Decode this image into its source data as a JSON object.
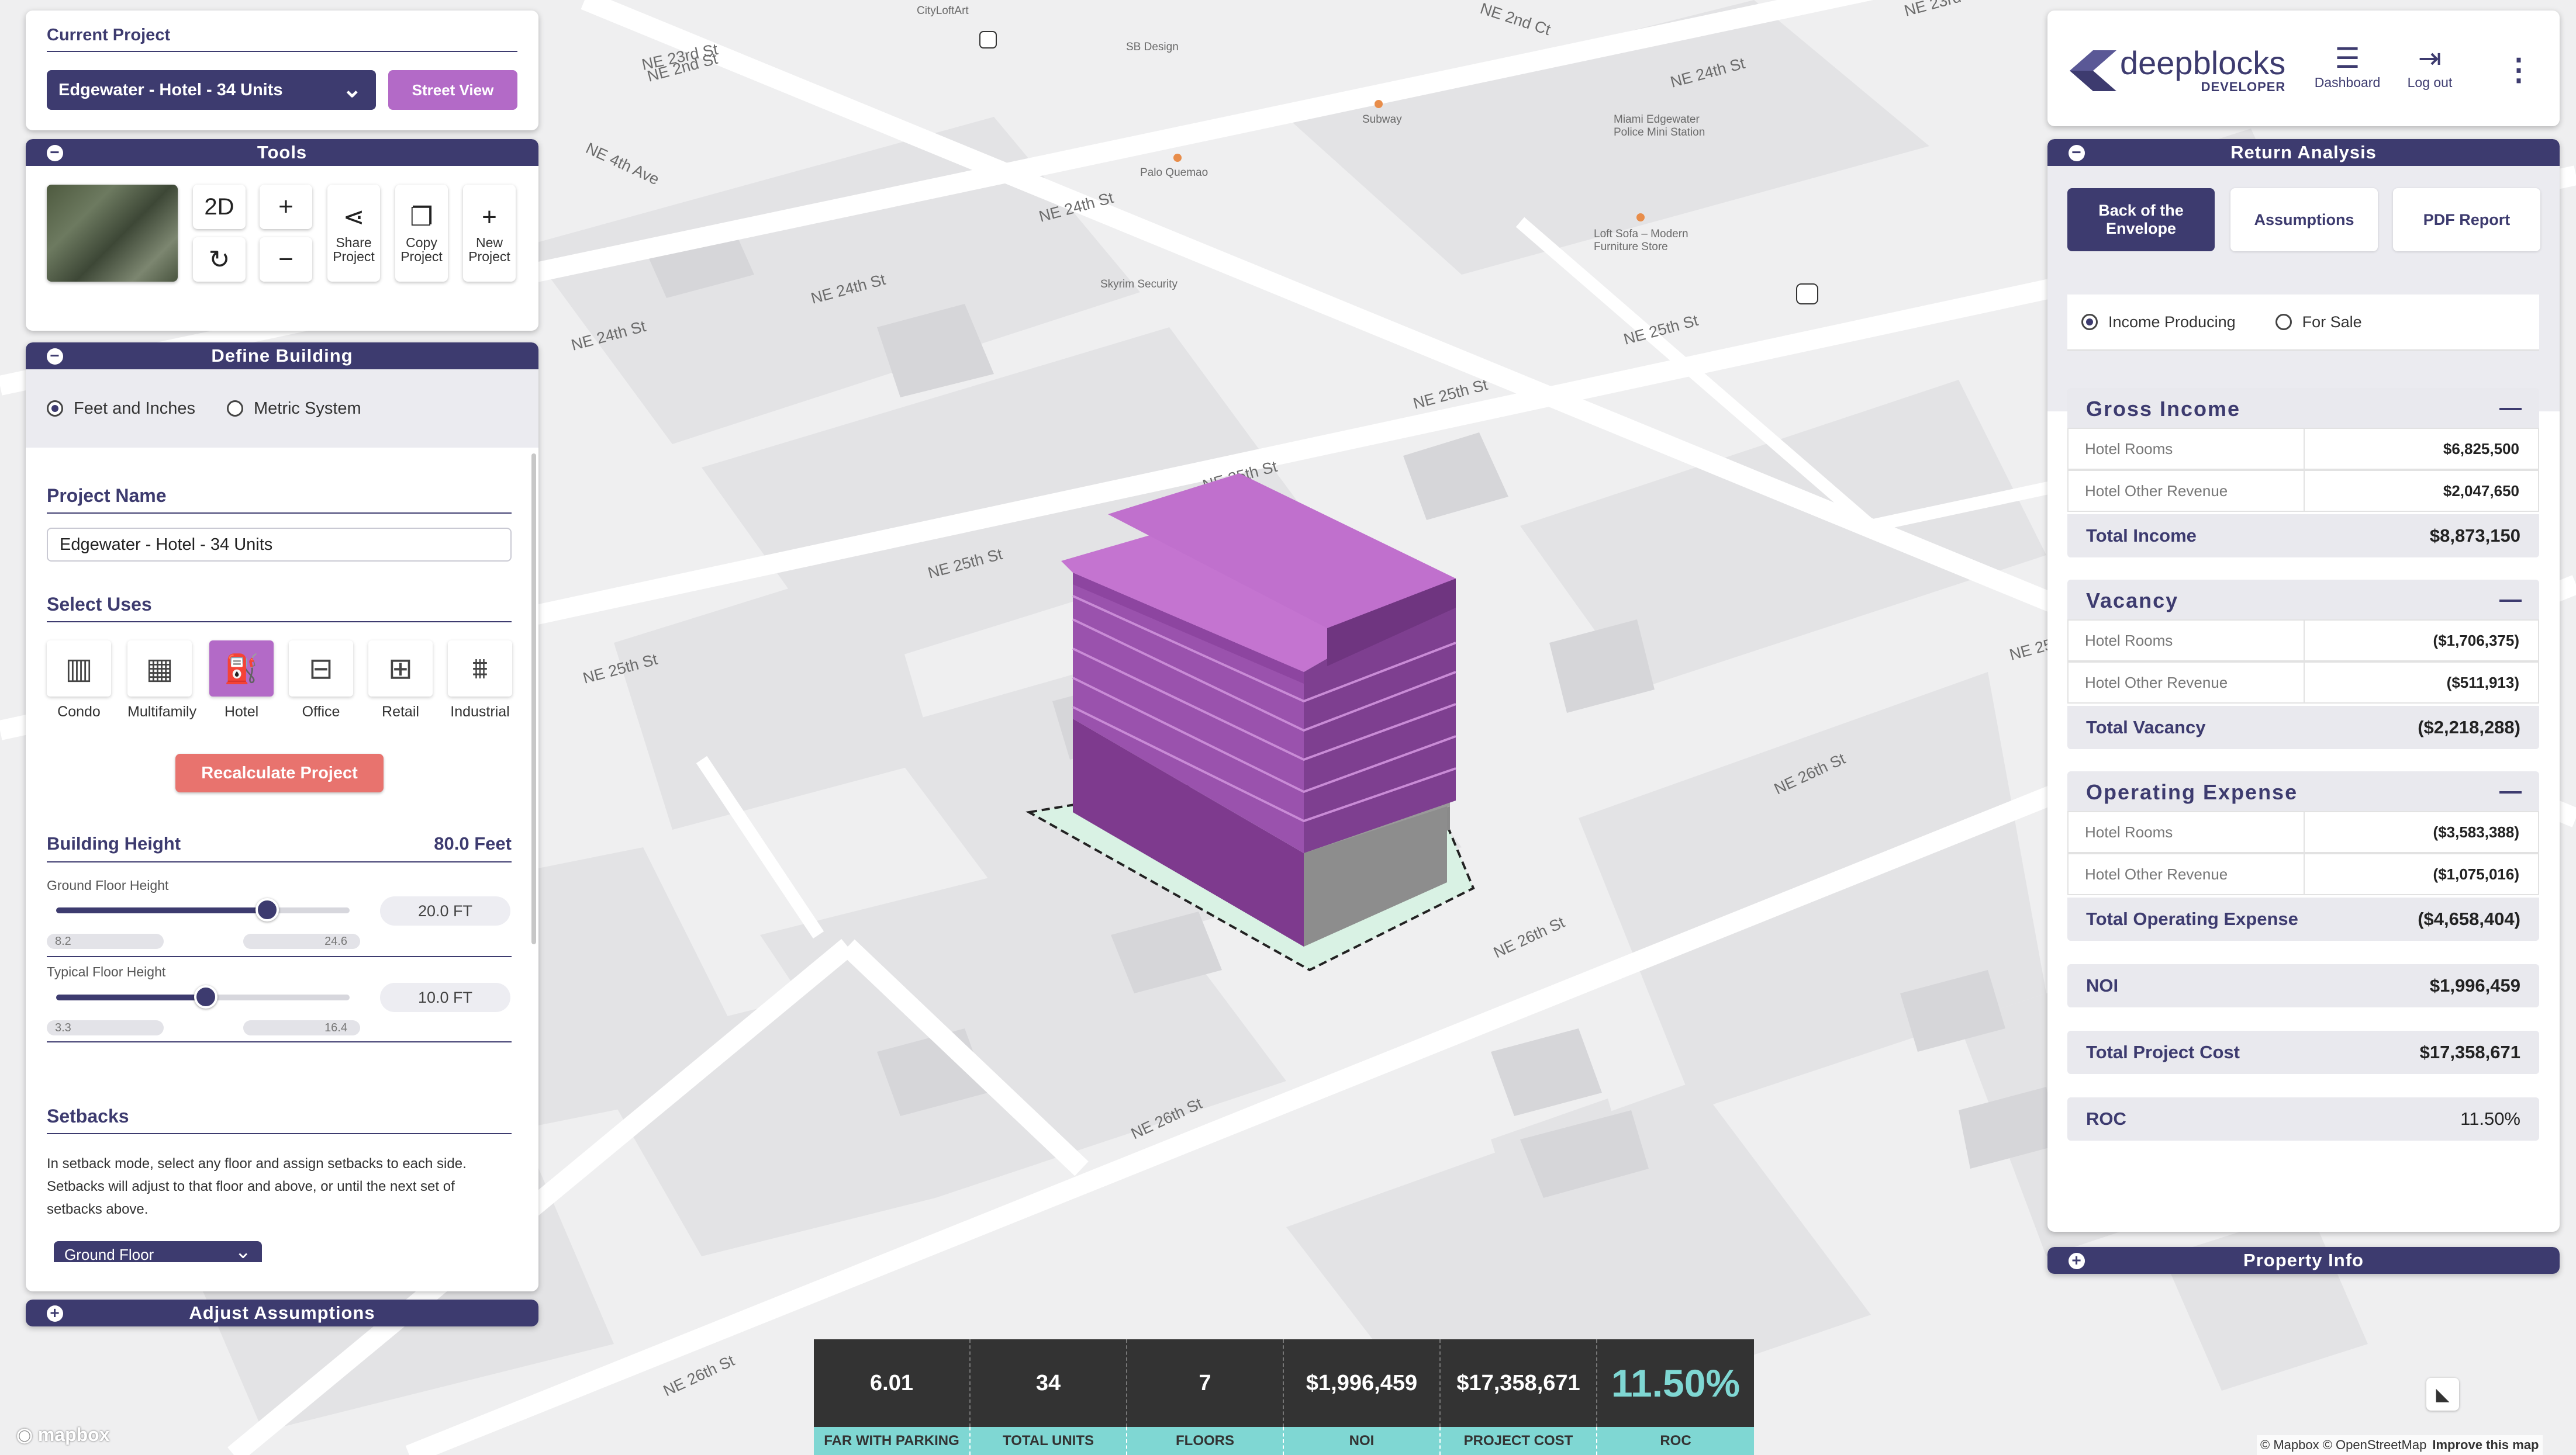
{
  "current_project": {
    "heading": "Current Project",
    "selected": "Edgewater - Hotel - 34 Units",
    "street_view": "Street View"
  },
  "tools": {
    "title": "Tools",
    "mode": "2D",
    "share": "Share Project",
    "copy": "Copy Project",
    "new": "New Project"
  },
  "define_building": {
    "title": "Define Building",
    "units": {
      "imperial": "Feet and Inches",
      "metric": "Metric System",
      "selected": "imperial"
    },
    "project_name_label": "Project Name",
    "project_name": "Edgewater - Hotel - 34 Units",
    "select_uses_label": "Select Uses",
    "uses": [
      "Condo",
      "Multifamily",
      "Hotel",
      "Office",
      "Retail",
      "Industrial"
    ],
    "selected_use": "Hotel",
    "recalculate": "Recalculate Project",
    "building_height_label": "Building Height",
    "building_height": "80.0 Feet",
    "ground_floor": {
      "label": "Ground Floor Height",
      "value": "20.0 FT",
      "min": "8.2",
      "max": "24.6",
      "fraction": 0.72
    },
    "typical_floor": {
      "label": "Typical Floor Height",
      "value": "10.0 FT",
      "min": "3.3",
      "max": "16.4",
      "fraction": 0.51
    },
    "setbacks_label": "Setbacks",
    "setbacks_text": "In setback mode, select any floor and assign setbacks to each side. Setbacks will adjust to that floor and above, or until the next set of setbacks above.",
    "setback_floor": "Ground Floor"
  },
  "adjust_assumptions": "Adjust Assumptions",
  "header": {
    "brand": "deepblocks",
    "sub": "DEVELOPER",
    "dashboard": "Dashboard",
    "logout": "Log out"
  },
  "return_analysis": {
    "title": "Return Analysis",
    "tabs": [
      "Back of the Envelope",
      "Assumptions",
      "PDF Report"
    ],
    "mode": {
      "income": "Income Producing",
      "sale": "For Sale",
      "selected": "income"
    },
    "gross_income": {
      "title": "Gross Income",
      "rows": [
        [
          "Hotel Rooms",
          "$6,825,500"
        ],
        [
          "Hotel Other Revenue",
          "$2,047,650"
        ]
      ],
      "total_label": "Total Income",
      "total": "$8,873,150"
    },
    "vacancy": {
      "title": "Vacancy",
      "rows": [
        [
          "Hotel Rooms",
          "($1,706,375)"
        ],
        [
          "Hotel Other Revenue",
          "($511,913)"
        ]
      ],
      "total_label": "Total Vacancy",
      "total": "($2,218,288)"
    },
    "operating": {
      "title": "Operating Expense",
      "rows": [
        [
          "Hotel Rooms",
          "($3,583,388)"
        ],
        [
          "Hotel Other Revenue",
          "($1,075,016)"
        ]
      ],
      "total_label": "Total Operating Expense",
      "total": "($4,658,404)"
    },
    "noi": {
      "label": "NOI",
      "value": "$1,996,459"
    },
    "project_cost": {
      "label": "Total Project Cost",
      "value": "$17,358,671"
    },
    "roc": {
      "label": "ROC",
      "value": "11.50%"
    }
  },
  "property_info": "Property Info",
  "stats": [
    {
      "value": "6.01",
      "label": "FAR WITH PARKING"
    },
    {
      "value": "34",
      "label": "TOTAL UNITS"
    },
    {
      "value": "7",
      "label": "FLOORS"
    },
    {
      "value": "$1,996,459",
      "label": "NOI"
    },
    {
      "value": "$17,358,671",
      "label": "PROJECT COST"
    },
    {
      "value": "11.50%",
      "label": "ROC"
    }
  ],
  "map": {
    "streets": [
      "NE 23rd St",
      "NE 24th St",
      "NE 25th St",
      "NE 26th St",
      "NE 4th Ave",
      "NE 2nd Ct",
      "NE 24th St",
      "NE 25th St",
      "NE 25th St",
      "NE 26th St",
      "NE 26th St",
      "NE 26th St",
      "NE 25th St",
      "NE 24th St",
      "NE 23rd St",
      "NE 2nd St",
      "NE 24th St",
      "NE 25th St",
      "NE 25"
    ],
    "pois": [
      "SB Design",
      "Subway",
      "Palo Quemao",
      "Skyrim Security",
      "Miami Edgewater Police Mini Station",
      "Loft Sofa – Modern Furniture Store",
      "CityLoftArt"
    ],
    "attribution": "© Mapbox © OpenStreetMap",
    "improve": "Improve this map",
    "logo": "mapbox"
  }
}
